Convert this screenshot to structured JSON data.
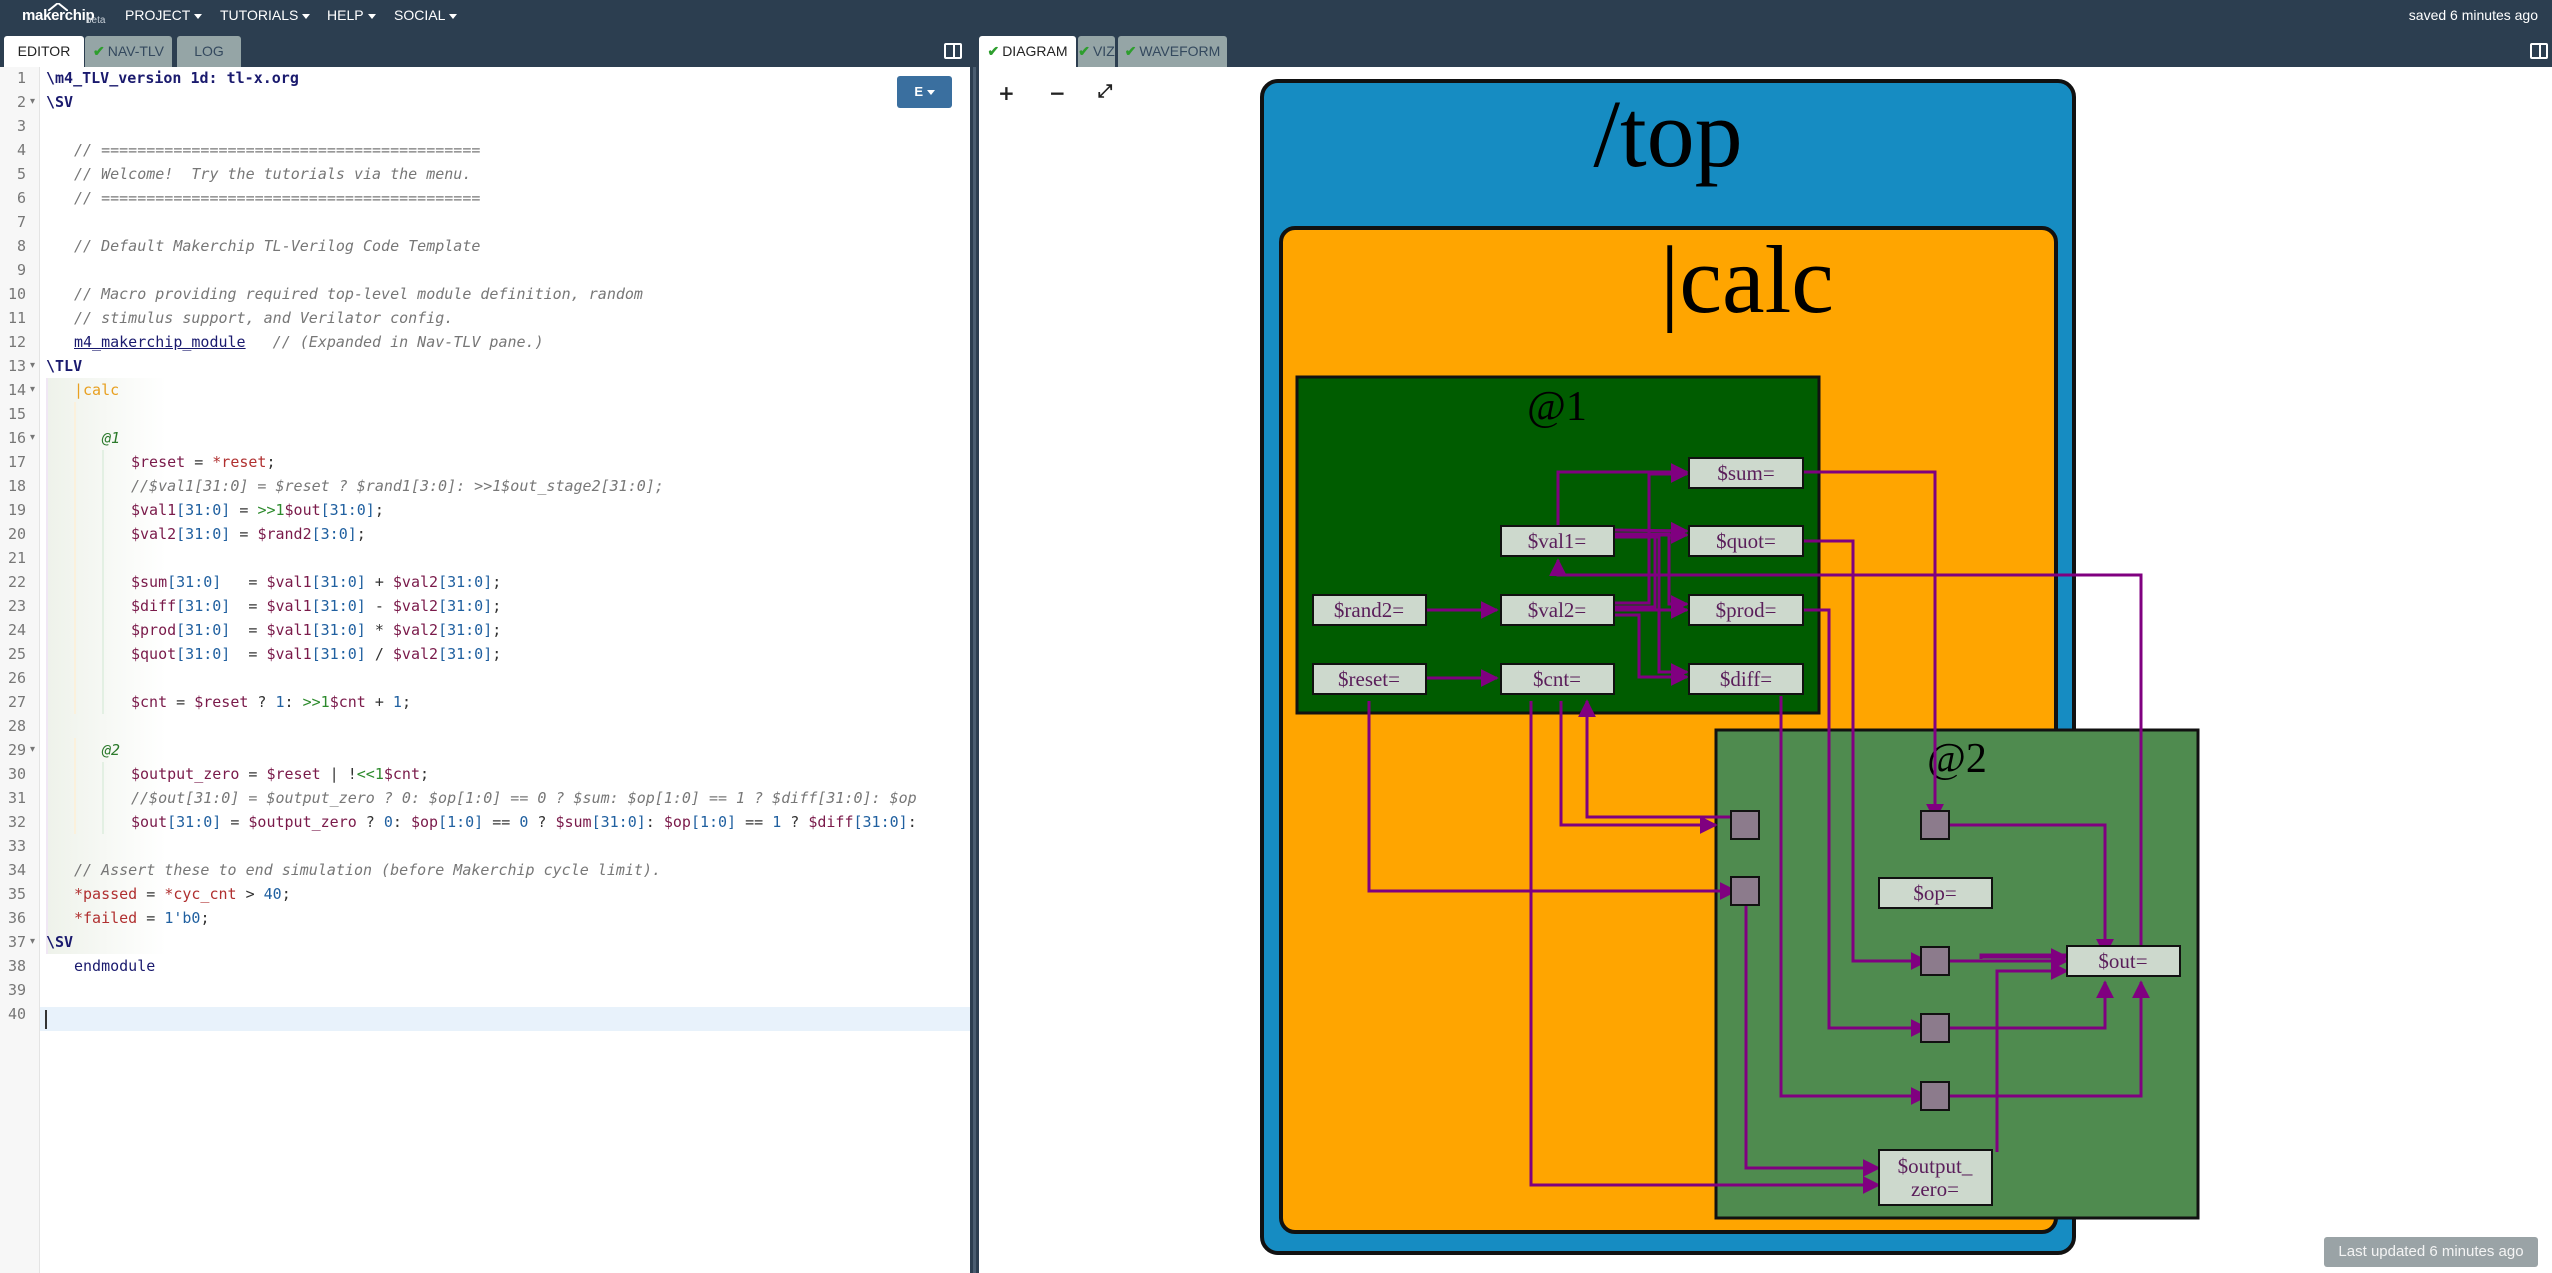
{
  "navbar": {
    "logo_text": "makerchip",
    "logo_beta": "beta",
    "menus": [
      "PROJECT",
      "TUTORIALS",
      "HELP",
      "SOCIAL"
    ],
    "saved_status": "saved 6 minutes ago"
  },
  "left_tabs": {
    "editor": "EDITOR",
    "nav_tlv": "NAV-TLV",
    "log": "LOG"
  },
  "right_tabs": {
    "diagram": "DIAGRAM",
    "viz": "VIZ",
    "waveform": "WAVEFORM"
  },
  "editor": {
    "e_button": "E",
    "line_numbers": [
      "1",
      "2",
      "3",
      "4",
      "5",
      "6",
      "7",
      "8",
      "9",
      "10",
      "11",
      "12",
      "13",
      "14",
      "15",
      "16",
      "17",
      "18",
      "19",
      "20",
      "21",
      "22",
      "23",
      "24",
      "25",
      "26",
      "27",
      "28",
      "29",
      "30",
      "31",
      "32",
      "33",
      "34",
      "35",
      "36",
      "37",
      "38",
      "39",
      "40"
    ],
    "fold_marker": "▾",
    "lines": {
      "l1a": "\\m4_TLV_version 1d: tl-x.org",
      "l2": "\\SV",
      "l4": "// ==========================================",
      "l5": "// Welcome!  Try the tutorials via the menu.",
      "l6": "// ==========================================",
      "l8": "// Default Makerchip TL-Verilog Code Template",
      "l10": "// Macro providing required top-level module definition, random",
      "l11": "// stimulus support, and Verilator config.",
      "l12a": "m4_makerchip_module",
      "l12b": "   // (Expanded in Nav-TLV pane.)",
      "l13": "\\TLV",
      "l14": "|calc",
      "l16": "@1",
      "l17a": "$reset",
      "l17b": " = ",
      "l17c": "*reset",
      "l17d": ";",
      "l18": "//$val1[31:0] = $reset ? $rand1[3:0]: >>1$out_stage2[31:0];",
      "l19a": "$val1",
      "l19b": "[31:0]",
      "l19c": " = ",
      "l19d": ">>1",
      "l19e": "$out",
      "l19f": "[31:0]",
      "l19g": ";",
      "l20a": "$val2",
      "l20b": "[31:0]",
      "l20c": " = ",
      "l20d": "$rand2",
      "l20e": "[3:0]",
      "l20f": ";",
      "l22a": "$sum",
      "l22b": "[31:0]",
      "l22c": "   = ",
      "l22d": "$val1",
      "l22e": "[31:0]",
      "l22f": " + ",
      "l22g": "$val2",
      "l22h": "[31:0]",
      "l22i": ";",
      "l23a": "$diff",
      "l23c": "  = ",
      "l23f": " - ",
      "l24a": "$prod",
      "l24f": " * ",
      "l25a": "$quot",
      "l25f": " / ",
      "l27a": "$cnt",
      "l27b": " = ",
      "l27c": "$reset",
      "l27d": " ? ",
      "l27e": "1",
      "l27f": ": ",
      "l27g": ">>1",
      "l27h": "$cnt",
      "l27i": " + ",
      "l27j": "1",
      "l27k": ";",
      "l29": "@2",
      "l30a": "$output_zero",
      "l30b": " = ",
      "l30c": "$reset",
      "l30d": " | !",
      "l30e": "<<1",
      "l30f": "$cnt",
      "l30g": ";",
      "l31": "//$out[31:0] = $output_zero ? 0: $op[1:0] == 0 ? $sum: $op[1:0] == 1 ? $diff[31:0]: $op",
      "l32a": "$out",
      "l32b": "[31:0]",
      "l32c": " = ",
      "l32d": "$output_zero",
      "l32e": " ? ",
      "l32f": "0",
      "l32g": ": ",
      "l32h": "$op",
      "l32i": "[1:0]",
      "l32j": " == ",
      "l32k": "0",
      "l32l": " ? ",
      "l32m": "$sum",
      "l32n": "[31:0]",
      "l32o": ": ",
      "l32p": "$op",
      "l32q": "[1:0]",
      "l32r": " == ",
      "l32s": "1",
      "l32t": " ? ",
      "l32u": "$diff",
      "l32v": "[31:0]",
      "l32w": ":",
      "l34": "// Assert these to end simulation (before Makerchip cycle limit).",
      "l35a": "*passed",
      "l35b": " = ",
      "l35c": "*cyc_cnt",
      "l35d": " > ",
      "l35e": "40",
      "l35f": ";",
      "l36a": "*failed",
      "l36b": " = ",
      "l36c": "1'b0",
      "l36d": ";",
      "l37": "\\SV",
      "l38": "endmodule"
    }
  },
  "diagram": {
    "zoom_in": "+",
    "zoom_out": "−",
    "fit": "⤢",
    "top_label": "/top",
    "pipe_label": "|calc",
    "stage1_label": "@1",
    "stage2_label": "@2",
    "nodes": {
      "sum": "$sum=",
      "quot": "$quot=",
      "val1": "$val1=",
      "rand2": "$rand2=",
      "val2": "$val2=",
      "prod": "$prod=",
      "reset": "$reset=",
      "cnt": "$cnt=",
      "diff": "$diff=",
      "op": "$op=",
      "out": "$out=",
      "output_zero_1": "$output_",
      "output_zero_2": "zero="
    },
    "colors": {
      "top_fill": "#168cc2",
      "pipe_fill": "#ffa500",
      "stage1_fill": "#005c00",
      "stage2_fill": "#4f8b4f",
      "node_fill": "#cdd9cd",
      "edge_color": "#800080",
      "stage_port_fill": "#8c7b8c"
    }
  },
  "footer": {
    "last_updated": "Last updated 6 minutes ago"
  }
}
